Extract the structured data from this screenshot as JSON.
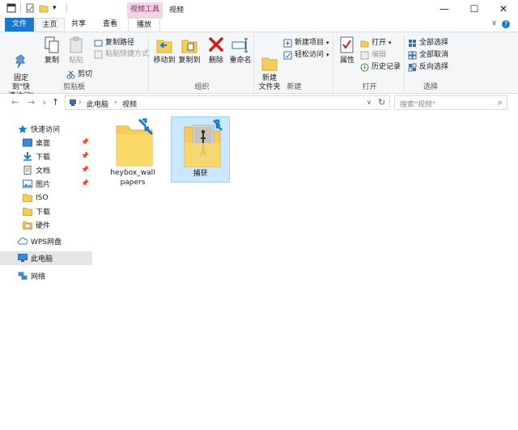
{
  "titlebar": {
    "context_tools": "视频工具",
    "title": "视频",
    "minimize": "—",
    "maximize": "☐",
    "close": "✕"
  },
  "tabs": {
    "file": "文件",
    "home": "主页",
    "share": "共享",
    "view": "查看",
    "play": "播放",
    "help": "?",
    "collapse": "∨"
  },
  "ribbon": {
    "clipboard": {
      "label": "剪贴板",
      "pin_quick_access": "固定到\"快\n速访问\"",
      "copy": "复制",
      "paste": "粘贴",
      "copy_path": "复制路径",
      "paste_shortcut": "粘贴快捷方式",
      "cut": "剪切"
    },
    "organize": {
      "label": "组织",
      "move_to": "移动到",
      "copy_to": "复制到",
      "delete": "删除",
      "rename": "重命名"
    },
    "new": {
      "label": "新建",
      "new_folder": "新建\n文件夹",
      "new_item": "新建项目",
      "easy_access": "轻松访问"
    },
    "open": {
      "label": "打开",
      "properties": "属性",
      "open": "打开",
      "edit": "编辑",
      "history": "历史记录"
    },
    "select": {
      "label": "选择",
      "select_all": "全部选择",
      "select_none": "全部取消",
      "invert": "反向选择"
    }
  },
  "address": {
    "back": "←",
    "forward": "→",
    "recent": "∨",
    "up": "↑",
    "sep": "›",
    "crumbs": [
      "此电脑",
      "视频"
    ],
    "dropdown": "∨",
    "refresh": "↻",
    "search_placeholder": "搜索\"视频\"",
    "search_icon": "⌕"
  },
  "navpane": {
    "quick_access": "快速访问",
    "items": [
      "桌面",
      "下载",
      "文档",
      "图片",
      "ISO",
      "下载",
      "硬件"
    ],
    "wps": "WPS网盘",
    "this_pc": "此电脑",
    "network": "网络"
  },
  "files": [
    {
      "name": "heybox_wallpapers"
    },
    {
      "name": "捕获"
    }
  ],
  "colors": {
    "accent": "#1979ca",
    "context_tab": "#f4d3e6",
    "selection": "#cce8ff"
  }
}
